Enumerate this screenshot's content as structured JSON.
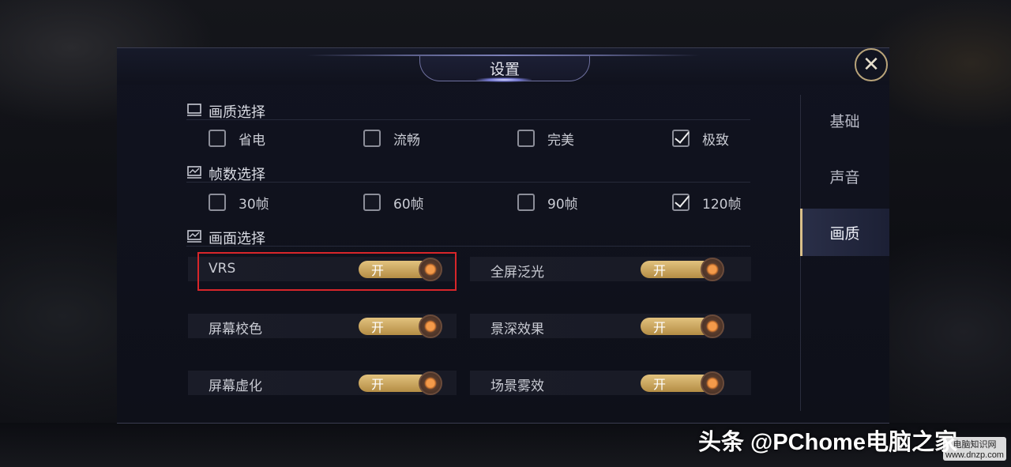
{
  "dialog": {
    "title": "设置",
    "close_symbol": "✕"
  },
  "sidebar": {
    "items": [
      {
        "label": "基础",
        "active": false
      },
      {
        "label": "声音",
        "active": false
      },
      {
        "label": "画质",
        "active": true
      }
    ]
  },
  "sections": {
    "quality": {
      "title": "画质选择",
      "icon": "monitor-icon",
      "options": [
        {
          "label": "省电",
          "checked": false
        },
        {
          "label": "流畅",
          "checked": false
        },
        {
          "label": "完美",
          "checked": false
        },
        {
          "label": "极致",
          "checked": true
        }
      ]
    },
    "fps": {
      "title": "帧数选择",
      "icon": "chart-monitor-icon",
      "options": [
        {
          "label": "30帧",
          "checked": false
        },
        {
          "label": "60帧",
          "checked": false
        },
        {
          "label": "90帧",
          "checked": false
        },
        {
          "label": "120帧",
          "checked": true
        }
      ]
    },
    "display": {
      "title": "画面选择",
      "icon": "chart-monitor-icon",
      "toggles": [
        {
          "label": "VRS",
          "state": "开"
        },
        {
          "label": "全屏泛光",
          "state": "开"
        },
        {
          "label": "屏幕校色",
          "state": "开"
        },
        {
          "label": "景深效果",
          "state": "开"
        },
        {
          "label": "屏幕虚化",
          "state": "开"
        },
        {
          "label": "场景雾效",
          "state": "开"
        }
      ]
    }
  },
  "watermark": {
    "main": "头条 @PChome电脑之家",
    "site_name": "电脑知识网",
    "site_url": "www.dnzp.com"
  },
  "colors": {
    "accent_gold": "#d9c08a",
    "toggle_on": "#c9a55e",
    "highlight_red": "#d8262a"
  }
}
